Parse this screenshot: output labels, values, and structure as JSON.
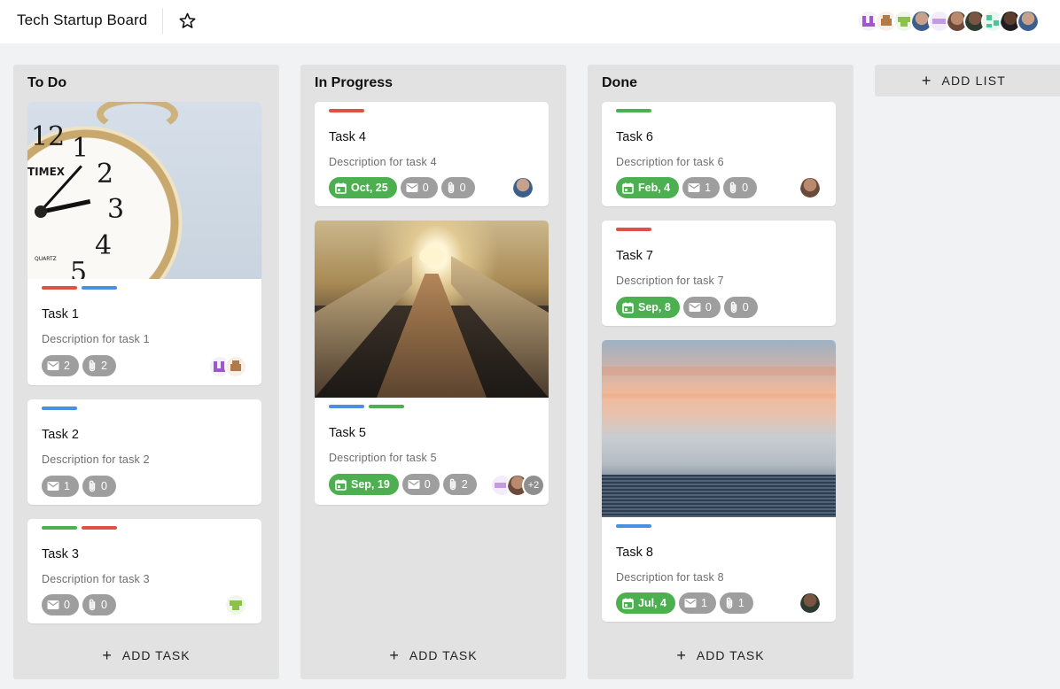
{
  "header": {
    "title": "Tech Startup Board"
  },
  "add_list_label": "ADD LIST",
  "add_task_label": "ADD TASK",
  "lists": [
    {
      "title": "To Do",
      "cards": [
        {
          "title": "Task 1",
          "description": "Description for task 1",
          "comments": "2",
          "attachments": "2",
          "labels": [
            "#e05145",
            "#4a90e2"
          ]
        },
        {
          "title": "Task 2",
          "description": "Description for task 2",
          "comments": "1",
          "attachments": "0",
          "labels": [
            "#4a90e2"
          ]
        },
        {
          "title": "Task 3",
          "description": "Description for task 3",
          "comments": "0",
          "attachments": "0",
          "labels": [
            "#4caf50",
            "#e05145"
          ]
        }
      ]
    },
    {
      "title": "In Progress",
      "cards": [
        {
          "title": "Task 4",
          "description": "Description for task 4",
          "due": "Oct, 25",
          "comments": "0",
          "attachments": "0",
          "labels": [
            "#e05145"
          ]
        },
        {
          "title": "Task 5",
          "description": "Description for task 5",
          "due": "Sep, 19",
          "comments": "0",
          "attachments": "2",
          "more_members": "+2",
          "labels": [
            "#4a90e2",
            "#4caf50"
          ]
        }
      ]
    },
    {
      "title": "Done",
      "cards": [
        {
          "title": "Task 6",
          "description": "Description for task 6",
          "due": "Feb, 4",
          "comments": "1",
          "attachments": "0",
          "labels": [
            "#4caf50"
          ]
        },
        {
          "title": "Task 7",
          "description": "Description for task 7",
          "due": "Sep, 8",
          "comments": "0",
          "attachments": "0",
          "labels": [
            "#e05145"
          ]
        },
        {
          "title": "Task 8",
          "description": "Description for task 8",
          "due": "Jul, 4",
          "comments": "1",
          "attachments": "1",
          "labels": [
            "#4a90e2"
          ]
        }
      ]
    }
  ],
  "colors": {
    "label_red": "#e05145",
    "label_blue": "#4a90e2",
    "label_green": "#4caf50",
    "date_chip": "#4caf50",
    "count_chip": "#9e9e9e"
  },
  "icons": [
    "star-outline-icon",
    "plus-icon",
    "calendar-icon",
    "mail-icon",
    "paperclip-icon"
  ]
}
